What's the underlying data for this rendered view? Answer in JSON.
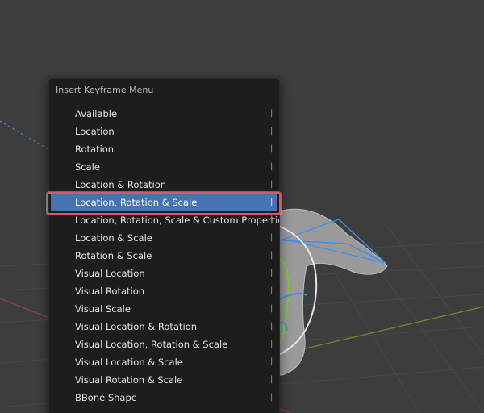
{
  "menu": {
    "title": "Insert Keyframe Menu",
    "items": [
      {
        "label": "Available",
        "shortcut": "|",
        "active": false
      },
      {
        "label": "Location",
        "shortcut": "|",
        "active": false
      },
      {
        "label": "Rotation",
        "shortcut": "|",
        "active": false
      },
      {
        "label": "Scale",
        "shortcut": "|",
        "active": false
      },
      {
        "label": "Location & Rotation",
        "shortcut": "|",
        "active": false
      },
      {
        "label": "Location, Rotation & Scale",
        "shortcut": "|",
        "active": true
      },
      {
        "label": "Location, Rotation, Scale & Custom Properties",
        "shortcut": "|",
        "active": false
      },
      {
        "label": "Location & Scale",
        "shortcut": "|",
        "active": false
      },
      {
        "label": "Rotation & Scale",
        "shortcut": "|",
        "active": false
      },
      {
        "label": "Visual Location",
        "shortcut": "|",
        "active": false
      },
      {
        "label": "Visual Rotation",
        "shortcut": "|",
        "active": false
      },
      {
        "label": "Visual Scale",
        "shortcut": "|",
        "active": false
      },
      {
        "label": "Visual Location & Rotation",
        "shortcut": "|",
        "active": false
      },
      {
        "label": "Visual Location, Rotation & Scale",
        "shortcut": "|",
        "active": false
      },
      {
        "label": "Visual Location & Scale",
        "shortcut": "|",
        "active": false
      },
      {
        "label": "Visual Rotation & Scale",
        "shortcut": "|",
        "active": false
      },
      {
        "label": "BBone Shape",
        "shortcut": "|",
        "active": false
      }
    ]
  },
  "colors": {
    "viewport_bg": "#3d3d3d",
    "menu_bg": "#1d1d1d",
    "active_item": "#4772b3",
    "highlight_outline": "#e05562",
    "x_axis": "#9c3b44",
    "y_axis": "#6b8a2a",
    "gizmo_blue": "#3e8ee8",
    "gizmo_green": "#7ecb3a"
  }
}
